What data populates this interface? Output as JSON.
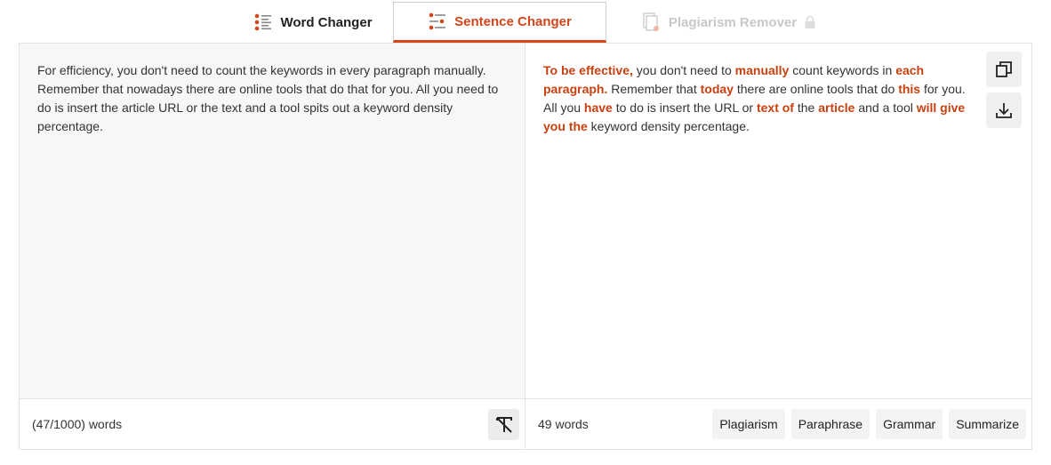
{
  "tabs": {
    "word_changer": "Word Changer",
    "sentence_changer": "Sentence Changer",
    "plagiarism_remover": "Plagiarism Remover"
  },
  "colors": {
    "accent": "#d4451a",
    "highlight": "#c9400f",
    "disabled": "#c8c8c8"
  },
  "input": {
    "text": "For efficiency, you don't need to count the keywords in every paragraph manually. Remember that nowadays there are online tools that do that for you. All you need to do is insert the article URL or the text and a tool spits out a keyword density percentage.",
    "word_count": "(47/1000) words"
  },
  "output": {
    "segments": [
      {
        "text": "To be effective,",
        "changed": true
      },
      {
        "text": " you don't need to ",
        "changed": false
      },
      {
        "text": "manually",
        "changed": true
      },
      {
        "text": " count keywords in ",
        "changed": false
      },
      {
        "text": "each paragraph.",
        "changed": true
      },
      {
        "text": " Remember that ",
        "changed": false
      },
      {
        "text": "today",
        "changed": true
      },
      {
        "text": " there are online tools that do ",
        "changed": false
      },
      {
        "text": "this",
        "changed": true
      },
      {
        "text": " for you. All you ",
        "changed": false
      },
      {
        "text": "have",
        "changed": true
      },
      {
        "text": " to do is insert the URL or ",
        "changed": false
      },
      {
        "text": "text of",
        "changed": true
      },
      {
        "text": " the ",
        "changed": false
      },
      {
        "text": "article",
        "changed": true
      },
      {
        "text": " and a tool ",
        "changed": false
      },
      {
        "text": "will give you the",
        "changed": true
      },
      {
        "text": " keyword density percentage.",
        "changed": false
      }
    ],
    "word_count": "49 words"
  },
  "actions": {
    "plagiarism": "Plagiarism",
    "paraphrase": "Paraphrase",
    "grammar": "Grammar",
    "summarize": "Summarize"
  },
  "icons": {
    "word_changer": "list-icon",
    "sentence_changer": "sliders-icon",
    "plagiarism_remover": "document-icon",
    "lock": "lock-icon",
    "clear": "clear-format-icon",
    "copy": "copy-icon",
    "download": "download-icon"
  }
}
